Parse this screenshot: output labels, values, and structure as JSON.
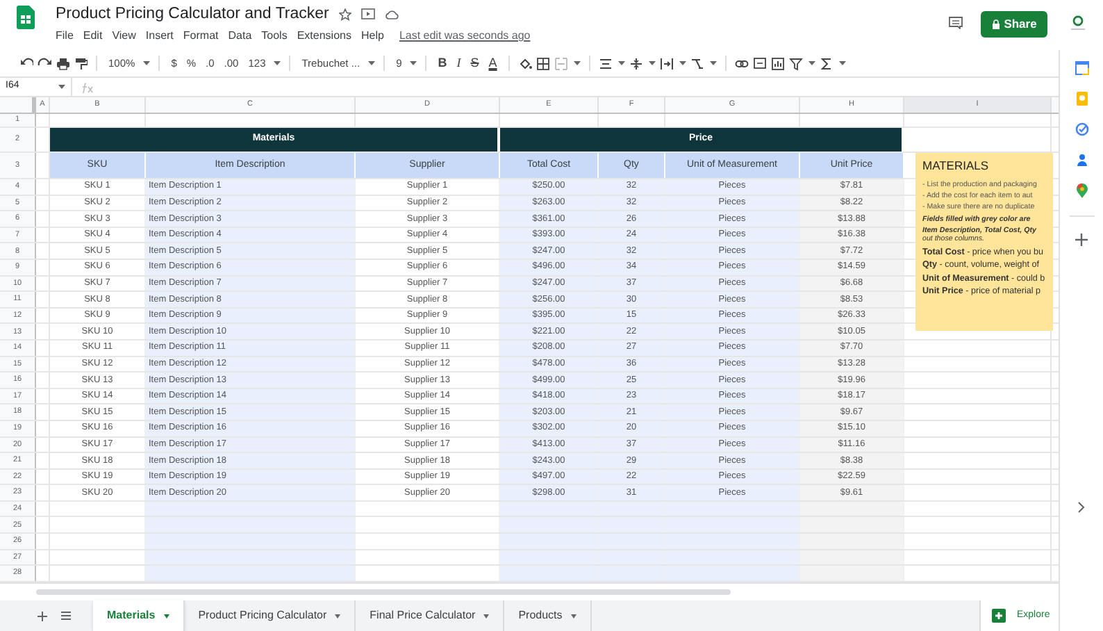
{
  "app": {
    "title": "Product Pricing Calculator and Tracker",
    "menus": [
      "File",
      "Edit",
      "View",
      "Insert",
      "Format",
      "Data",
      "Tools",
      "Extensions",
      "Help"
    ],
    "last_edit": "Last edit was seconds ago",
    "share": "Share"
  },
  "toolbar": [
    {
      "kind": "icon"
    },
    {
      "kind": "icon"
    },
    {
      "kind": "icon"
    },
    {
      "kind": "icon"
    },
    {
      "kind": "sep"
    },
    {
      "kind": "text",
      "text": "100%"
    },
    {
      "kind": "sep"
    },
    {
      "kind": "text",
      "text": "$"
    },
    {
      "kind": "text",
      "text": "%"
    },
    {
      "kind": "text",
      "text": ".0"
    },
    {
      "kind": "text",
      "text": ".00"
    },
    {
      "kind": "text",
      "text": "123"
    },
    {
      "kind": "sep"
    },
    {
      "kind": "text",
      "text": "Trebuchet ..."
    },
    {
      "kind": "sep"
    },
    {
      "kind": "text",
      "text": "9"
    },
    {
      "kind": "sep"
    },
    {
      "kind": "text",
      "text": "B"
    },
    {
      "kind": "text",
      "text": "I"
    },
    {
      "kind": "text",
      "text": "S"
    },
    {
      "kind": "text",
      "text": "A"
    },
    {
      "kind": "sep"
    },
    {
      "kind": "icon"
    },
    {
      "kind": "icon"
    },
    {
      "kind": "icon"
    },
    {
      "kind": "sep"
    },
    {
      "kind": "icon"
    },
    {
      "kind": "icon"
    },
    {
      "kind": "icon"
    },
    {
      "kind": "icon"
    },
    {
      "kind": "sep"
    },
    {
      "kind": "icon"
    },
    {
      "kind": "icon"
    },
    {
      "kind": "icon"
    },
    {
      "kind": "icon"
    },
    {
      "kind": "icon"
    }
  ],
  "name_box": "I64",
  "columns": [
    "A",
    "B",
    "C",
    "D",
    "E",
    "F",
    "G",
    "H",
    "I"
  ],
  "row_numbers": [
    "1",
    "2",
    "3",
    "4",
    "5",
    "6",
    "7",
    "8",
    "9",
    "10",
    "11",
    "12",
    "13",
    "14",
    "15",
    "16",
    "17",
    "18",
    "19",
    "20",
    "21",
    "22",
    "23",
    "24",
    "25",
    "26",
    "27",
    "28"
  ],
  "table": {
    "groups": [
      "Materials",
      "Price"
    ],
    "headers": [
      "SKU",
      "Item Description",
      "Supplier",
      "Total Cost",
      "Qty",
      "Unit of Measurement",
      "Unit Price"
    ],
    "rows": [
      [
        "SKU 1",
        "Item Description 1",
        "Supplier 1",
        "$250.00",
        "32",
        "Pieces",
        "$7.81"
      ],
      [
        "SKU 2",
        "Item Description 2",
        "Supplier 2",
        "$263.00",
        "32",
        "Pieces",
        "$8.22"
      ],
      [
        "SKU 3",
        "Item Description 3",
        "Supplier 3",
        "$361.00",
        "26",
        "Pieces",
        "$13.88"
      ],
      [
        "SKU 4",
        "Item Description 4",
        "Supplier 4",
        "$393.00",
        "24",
        "Pieces",
        "$16.38"
      ],
      [
        "SKU 5",
        "Item Description 5",
        "Supplier 5",
        "$247.00",
        "32",
        "Pieces",
        "$7.72"
      ],
      [
        "SKU 6",
        "Item Description 6",
        "Supplier 6",
        "$496.00",
        "34",
        "Pieces",
        "$14.59"
      ],
      [
        "SKU 7",
        "Item Description 7",
        "Supplier 7",
        "$247.00",
        "37",
        "Pieces",
        "$6.68"
      ],
      [
        "SKU 8",
        "Item Description 8",
        "Supplier 8",
        "$256.00",
        "30",
        "Pieces",
        "$8.53"
      ],
      [
        "SKU 9",
        "Item Description 9",
        "Supplier 9",
        "$395.00",
        "15",
        "Pieces",
        "$26.33"
      ],
      [
        "SKU 10",
        "Item Description 10",
        "Supplier 10",
        "$221.00",
        "22",
        "Pieces",
        "$10.05"
      ],
      [
        "SKU 11",
        "Item Description 11",
        "Supplier 11",
        "$208.00",
        "27",
        "Pieces",
        "$7.70"
      ],
      [
        "SKU 12",
        "Item Description 12",
        "Supplier 12",
        "$478.00",
        "36",
        "Pieces",
        "$13.28"
      ],
      [
        "SKU 13",
        "Item Description 13",
        "Supplier 13",
        "$499.00",
        "25",
        "Pieces",
        "$19.96"
      ],
      [
        "SKU 14",
        "Item Description 14",
        "Supplier 14",
        "$418.00",
        "23",
        "Pieces",
        "$18.17"
      ],
      [
        "SKU 15",
        "Item Description 15",
        "Supplier 15",
        "$203.00",
        "21",
        "Pieces",
        "$9.67"
      ],
      [
        "SKU 16",
        "Item Description 16",
        "Supplier 16",
        "$302.00",
        "20",
        "Pieces",
        "$15.10"
      ],
      [
        "SKU 17",
        "Item Description 17",
        "Supplier 17",
        "$413.00",
        "37",
        "Pieces",
        "$11.16"
      ],
      [
        "SKU 18",
        "Item Description 18",
        "Supplier 18",
        "$243.00",
        "29",
        "Pieces",
        "$8.38"
      ],
      [
        "SKU 19",
        "Item Description 19",
        "Supplier 19",
        "$497.00",
        "22",
        "Pieces",
        "$22.59"
      ],
      [
        "SKU 20",
        "Item Description 20",
        "Supplier 20",
        "$298.00",
        "31",
        "Pieces",
        "$9.61"
      ]
    ]
  },
  "note": {
    "title": "MATERIALS",
    "lines": [
      {
        "kind": "hint",
        "text": "- List the production and packaging"
      },
      {
        "kind": "hint",
        "text": "- Add the cost for each item to aut"
      },
      {
        "kind": "hint",
        "text": "- Make sure there are no duplicate"
      },
      {
        "kind": "bold-italic",
        "text": "Fields filled with grey color are"
      },
      {
        "kind": "bold-italic",
        "text": "Item Description, Total Cost, Qty"
      },
      {
        "kind": "italic",
        "text": "out those columns."
      },
      {
        "kind": "term",
        "text": "**Total Cost** - price when you bu"
      },
      {
        "kind": "term",
        "text": "**Qty** - count, volume, weight of"
      },
      {
        "kind": "term",
        "text": "**Unit of Measurement** - could b"
      },
      {
        "kind": "term",
        "text": "**Unit Price** - price of material p"
      }
    ]
  },
  "sheet_tabs": [
    {
      "label": "Materials",
      "selected": true
    },
    {
      "label": "Product Pricing Calculator",
      "selected": false
    },
    {
      "label": "Final Price Calculator",
      "selected": false
    },
    {
      "label": "Products",
      "selected": false
    }
  ],
  "explore": "Explore"
}
